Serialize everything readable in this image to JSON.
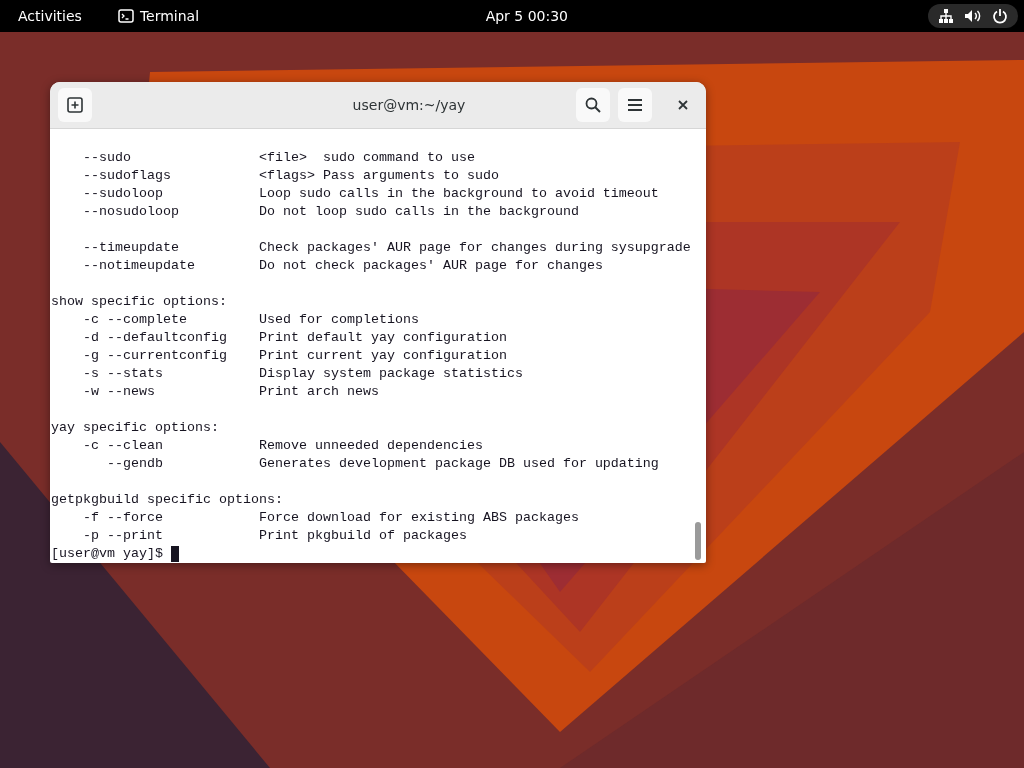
{
  "top_bar": {
    "activities": "Activities",
    "app": "Terminal",
    "clock": "Apr 5  00:30"
  },
  "terminal": {
    "title": "user@vm:~/yay",
    "blocks": [
      {
        "lines": [
          "    --sudo                <file>  sudo command to use",
          "    --sudoflags           <flags> Pass arguments to sudo",
          "    --sudoloop            Loop sudo calls in the background to avoid timeout",
          "    --nosudoloop          Do not loop sudo calls in the background"
        ]
      },
      {
        "lines": [
          "    --timeupdate          Check packages' AUR page for changes during sysupgrade",
          "    --notimeupdate        Do not check packages' AUR page for changes"
        ]
      },
      {
        "lines": [
          "show specific options:",
          "    -c --complete         Used for completions",
          "    -d --defaultconfig    Print default yay configuration",
          "    -g --currentconfig    Print current yay configuration",
          "    -s --stats            Display system package statistics",
          "    -w --news             Print arch news"
        ]
      },
      {
        "lines": [
          "yay specific options:",
          "    -c --clean            Remove unneeded dependencies",
          "       --gendb            Generates development package DB used for updating"
        ]
      },
      {
        "lines": [
          "getpkgbuild specific options:",
          "    -f --force            Force download for existing ABS packages",
          "    -p --print            Print pkgbuild of packages"
        ]
      }
    ],
    "prompt": "[user@vm yay]$ "
  }
}
